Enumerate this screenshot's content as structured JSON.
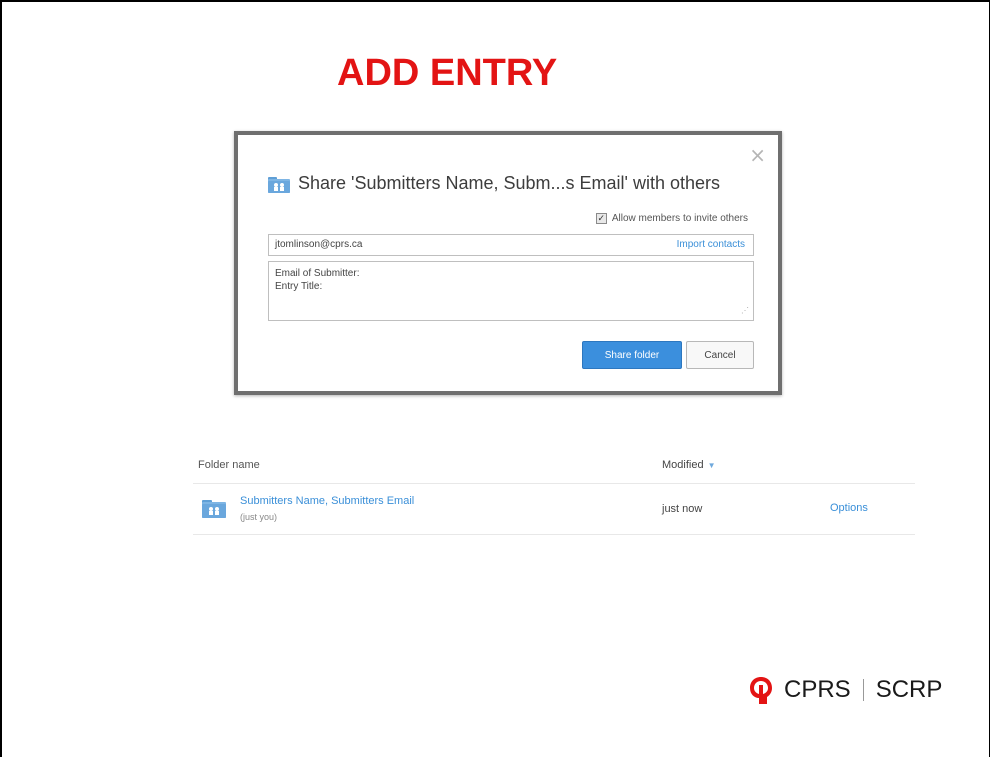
{
  "slide": {
    "title": "ADD ENTRY"
  },
  "dialog": {
    "close_glyph": "×",
    "title": "Share 'Submitters Name, Subm...s Email' with others",
    "allow_checkbox_label": "Allow members to invite others",
    "allow_checked": true,
    "email_value": "jtomlinson@cprs.ca",
    "import_contacts_label": "Import contacts",
    "message_lines": [
      "Email of Submitter:",
      "Entry Title:"
    ],
    "share_button_label": "Share folder",
    "cancel_button_label": "Cancel"
  },
  "file_list": {
    "columns": {
      "name": "Folder name",
      "modified": "Modified"
    },
    "rows": [
      {
        "name": "Submitters Name, Submitters Email",
        "sub": "(just you)",
        "modified": "just now",
        "options": "Options"
      }
    ]
  },
  "logo": {
    "left_text": "CPRS",
    "right_text": "SCRP"
  },
  "colors": {
    "title_red": "#e31414",
    "link_blue": "#3a8fd8",
    "primary_button": "#3b8fdd",
    "logo_red": "#e31414"
  },
  "icons": [
    "shared-folder-icon",
    "close-icon",
    "checkbox-checked-icon",
    "sort-down-icon",
    "resize-grip-icon",
    "cprs-logo-mark"
  ]
}
